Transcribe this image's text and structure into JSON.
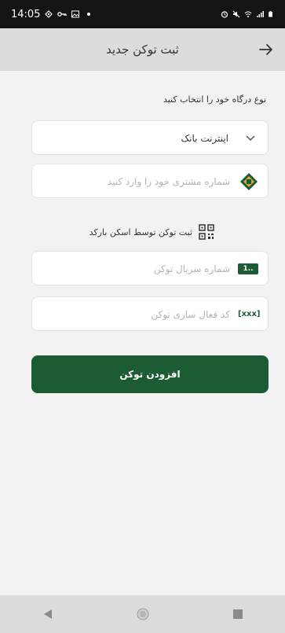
{
  "status_bar": {
    "time": "14:05"
  },
  "header": {
    "title": "ثبت توکن جدید",
    "back_icon": "arrow-right-icon"
  },
  "form": {
    "gateway_label": "نوع درگاه خود را انتخاب کنید",
    "gateway_select": {
      "value": "اینترنت بانک",
      "icon": "chevron-down-icon"
    },
    "customer_number": {
      "placeholder": "شماره مشتری خود را وارد کنید",
      "icon": "bank-logo-icon"
    },
    "scan_barcode": {
      "label": "ثبت توکن توسط اسکن بارکد",
      "icon": "qr-code-icon"
    },
    "serial_number": {
      "placeholder": "شماره سریال توکن",
      "icon": "serial-card-icon",
      "icon_text": "1.."
    },
    "activation_code": {
      "placeholder": "کد فعال سازی توکن",
      "icon": "code-brackets-icon",
      "icon_text": "[xxx]"
    },
    "submit_label": "افزودن توکن"
  },
  "colors": {
    "primary": "#1b5c35",
    "accent_icon": "#1b5c35",
    "gold": "#d4a33a"
  },
  "nav_bar": {
    "back": "nav-back-icon",
    "home": "nav-home-icon",
    "recents": "nav-recents-icon"
  }
}
